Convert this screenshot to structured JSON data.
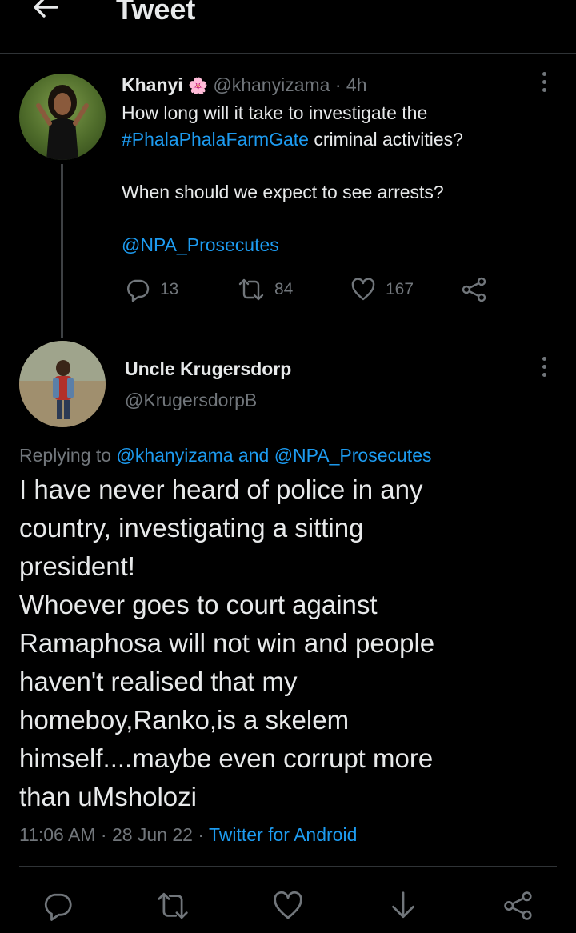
{
  "header": {
    "title": "Tweet",
    "back_icon": "arrow-left-icon"
  },
  "tweet1": {
    "display_name": "Khanyi",
    "name_emoji": "🌸",
    "handle": "@khanyizama",
    "separator": "·",
    "time": "4h",
    "text_line1": "How long will it take to investigate the",
    "hashtag": "#PhalaPhalaFarmGate",
    "text_line2_rest": " criminal activities?",
    "text_para2": "When should we expect to see arrests?",
    "mention": "@NPA_Prosecutes",
    "replies": "13",
    "retweets": "84",
    "likes": "167"
  },
  "tweet2": {
    "display_name": "Uncle Krugersdorp",
    "handle": "@KrugersdorpB",
    "replying_prefix": "Replying to ",
    "replying_user1": "@khanyizama",
    "replying_and": " and ",
    "replying_user2": "@NPA_Prosecutes",
    "text": "I have never heard of police in any\ncountry, investigating a sitting\npresident!\nWhoever goes to court against\nRamaphosa will not win and people\nhaven't realised that my\nhomeboy,Ranko,is a skelem\nhimself....maybe even corrupt more\nthan uMsholozi",
    "time": "11:06 AM",
    "dot1": " · ",
    "date": "28 Jun 22",
    "dot2": " · ",
    "source": "Twitter for Android"
  },
  "colors": {
    "background": "#000000",
    "text": "#e7e9ea",
    "muted": "#71767b",
    "link": "#1d9bf0",
    "divider": "#2f3336"
  }
}
